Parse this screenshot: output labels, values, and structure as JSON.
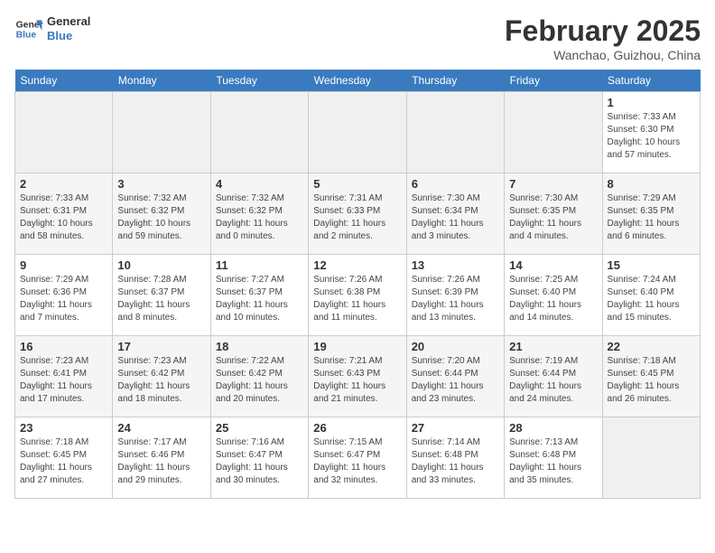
{
  "header": {
    "logo_line1": "General",
    "logo_line2": "Blue",
    "month_year": "February 2025",
    "location": "Wanchao, Guizhou, China"
  },
  "weekdays": [
    "Sunday",
    "Monday",
    "Tuesday",
    "Wednesday",
    "Thursday",
    "Friday",
    "Saturday"
  ],
  "weeks": [
    [
      {
        "day": "",
        "info": ""
      },
      {
        "day": "",
        "info": ""
      },
      {
        "day": "",
        "info": ""
      },
      {
        "day": "",
        "info": ""
      },
      {
        "day": "",
        "info": ""
      },
      {
        "day": "",
        "info": ""
      },
      {
        "day": "1",
        "info": "Sunrise: 7:33 AM\nSunset: 6:30 PM\nDaylight: 10 hours\nand 57 minutes."
      }
    ],
    [
      {
        "day": "2",
        "info": "Sunrise: 7:33 AM\nSunset: 6:31 PM\nDaylight: 10 hours\nand 58 minutes."
      },
      {
        "day": "3",
        "info": "Sunrise: 7:32 AM\nSunset: 6:32 PM\nDaylight: 10 hours\nand 59 minutes."
      },
      {
        "day": "4",
        "info": "Sunrise: 7:32 AM\nSunset: 6:32 PM\nDaylight: 11 hours\nand 0 minutes."
      },
      {
        "day": "5",
        "info": "Sunrise: 7:31 AM\nSunset: 6:33 PM\nDaylight: 11 hours\nand 2 minutes."
      },
      {
        "day": "6",
        "info": "Sunrise: 7:30 AM\nSunset: 6:34 PM\nDaylight: 11 hours\nand 3 minutes."
      },
      {
        "day": "7",
        "info": "Sunrise: 7:30 AM\nSunset: 6:35 PM\nDaylight: 11 hours\nand 4 minutes."
      },
      {
        "day": "8",
        "info": "Sunrise: 7:29 AM\nSunset: 6:35 PM\nDaylight: 11 hours\nand 6 minutes."
      }
    ],
    [
      {
        "day": "9",
        "info": "Sunrise: 7:29 AM\nSunset: 6:36 PM\nDaylight: 11 hours\nand 7 minutes."
      },
      {
        "day": "10",
        "info": "Sunrise: 7:28 AM\nSunset: 6:37 PM\nDaylight: 11 hours\nand 8 minutes."
      },
      {
        "day": "11",
        "info": "Sunrise: 7:27 AM\nSunset: 6:37 PM\nDaylight: 11 hours\nand 10 minutes."
      },
      {
        "day": "12",
        "info": "Sunrise: 7:26 AM\nSunset: 6:38 PM\nDaylight: 11 hours\nand 11 minutes."
      },
      {
        "day": "13",
        "info": "Sunrise: 7:26 AM\nSunset: 6:39 PM\nDaylight: 11 hours\nand 13 minutes."
      },
      {
        "day": "14",
        "info": "Sunrise: 7:25 AM\nSunset: 6:40 PM\nDaylight: 11 hours\nand 14 minutes."
      },
      {
        "day": "15",
        "info": "Sunrise: 7:24 AM\nSunset: 6:40 PM\nDaylight: 11 hours\nand 15 minutes."
      }
    ],
    [
      {
        "day": "16",
        "info": "Sunrise: 7:23 AM\nSunset: 6:41 PM\nDaylight: 11 hours\nand 17 minutes."
      },
      {
        "day": "17",
        "info": "Sunrise: 7:23 AM\nSunset: 6:42 PM\nDaylight: 11 hours\nand 18 minutes."
      },
      {
        "day": "18",
        "info": "Sunrise: 7:22 AM\nSunset: 6:42 PM\nDaylight: 11 hours\nand 20 minutes."
      },
      {
        "day": "19",
        "info": "Sunrise: 7:21 AM\nSunset: 6:43 PM\nDaylight: 11 hours\nand 21 minutes."
      },
      {
        "day": "20",
        "info": "Sunrise: 7:20 AM\nSunset: 6:44 PM\nDaylight: 11 hours\nand 23 minutes."
      },
      {
        "day": "21",
        "info": "Sunrise: 7:19 AM\nSunset: 6:44 PM\nDaylight: 11 hours\nand 24 minutes."
      },
      {
        "day": "22",
        "info": "Sunrise: 7:18 AM\nSunset: 6:45 PM\nDaylight: 11 hours\nand 26 minutes."
      }
    ],
    [
      {
        "day": "23",
        "info": "Sunrise: 7:18 AM\nSunset: 6:45 PM\nDaylight: 11 hours\nand 27 minutes."
      },
      {
        "day": "24",
        "info": "Sunrise: 7:17 AM\nSunset: 6:46 PM\nDaylight: 11 hours\nand 29 minutes."
      },
      {
        "day": "25",
        "info": "Sunrise: 7:16 AM\nSunset: 6:47 PM\nDaylight: 11 hours\nand 30 minutes."
      },
      {
        "day": "26",
        "info": "Sunrise: 7:15 AM\nSunset: 6:47 PM\nDaylight: 11 hours\nand 32 minutes."
      },
      {
        "day": "27",
        "info": "Sunrise: 7:14 AM\nSunset: 6:48 PM\nDaylight: 11 hours\nand 33 minutes."
      },
      {
        "day": "28",
        "info": "Sunrise: 7:13 AM\nSunset: 6:48 PM\nDaylight: 11 hours\nand 35 minutes."
      },
      {
        "day": "",
        "info": ""
      }
    ]
  ]
}
